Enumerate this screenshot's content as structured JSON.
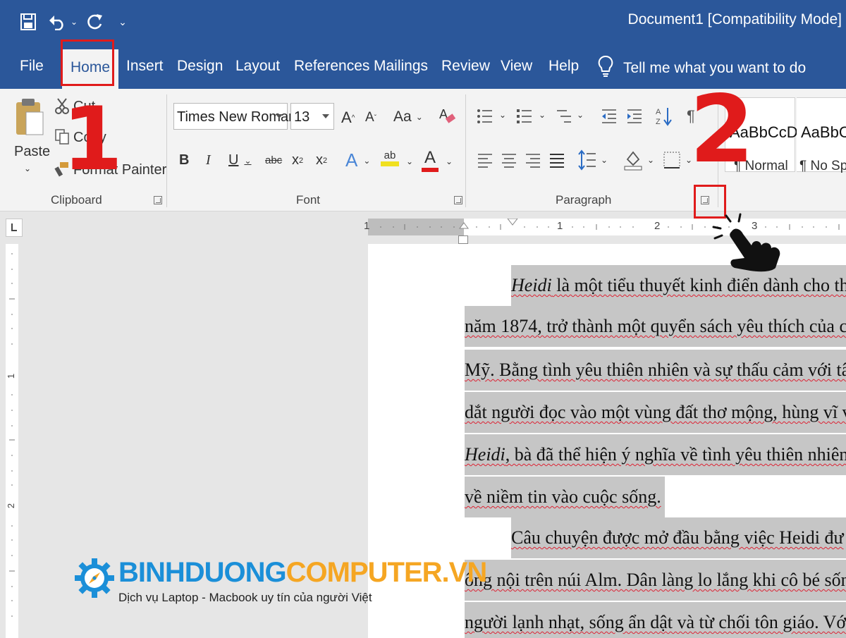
{
  "window": {
    "title": "Document1 [Compatibility Mode]"
  },
  "quick_access": {
    "save_icon": "save-icon",
    "undo_icon": "undo-icon",
    "redo_icon": "redo-icon"
  },
  "menu": {
    "tabs": [
      "File",
      "Home",
      "Insert",
      "Design",
      "Layout",
      "References",
      "Mailings",
      "Review",
      "View",
      "Help"
    ],
    "active": "Home",
    "tell_me": "Tell me what you want to do"
  },
  "clipboard": {
    "label": "Clipboard",
    "paste": "Paste",
    "cut": "Cut",
    "copy": "Copy",
    "format_painter": "Format Painter"
  },
  "font": {
    "label": "Font",
    "name": "Times New Romar",
    "size": "13",
    "bold": "B",
    "italic": "I",
    "underline": "U",
    "strike": "abc",
    "subscript": "x",
    "subscript_mark": "2",
    "superscript": "x",
    "superscript_mark": "2",
    "grow": "A",
    "shrink": "A",
    "case": "Aa",
    "effects": "A",
    "highlight": "ab",
    "color": "A"
  },
  "paragraph": {
    "label": "Paragraph",
    "pilcrow": "¶"
  },
  "styles": {
    "items": [
      {
        "sample": "AaBbCcD",
        "name": "¶ Normal"
      },
      {
        "sample": "AaBbC",
        "name": "¶ No Spa"
      }
    ]
  },
  "ruler": {
    "marks": [
      "1",
      "1",
      "2",
      "3"
    ],
    "vmarks": [
      "1",
      "2"
    ]
  },
  "document": {
    "lines": [
      {
        "parts": [
          {
            "t": "Heidi",
            "i": true
          },
          {
            "t": " là một tiểu thuyết kinh điển dành cho th"
          }
        ]
      },
      {
        "parts": [
          {
            "t": "năm 1874, trở thành một quyển sách yêu thích của c"
          }
        ]
      },
      {
        "parts": [
          {
            "t": "Mỹ. Bằng tình yêu thiên nhiên và sự thấu cảm với tâm"
          }
        ]
      },
      {
        "parts": [
          {
            "t": "dắt người đọc vào một vùng đất thơ mộng, hùng vĩ v"
          }
        ]
      },
      {
        "parts": [
          {
            "t": "Heidi",
            "i": true
          },
          {
            "t": ", bà đã thể hiện ý nghĩa về tình yêu thiên nhiên,"
          }
        ]
      },
      {
        "parts": [
          {
            "t": "về niềm tin vào cuộc sống."
          }
        ]
      },
      {
        "parts": [
          {
            "t": "Câu chuyện được mở đầu bằng việc Heidi đư"
          }
        ]
      },
      {
        "parts": [
          {
            "t": "ông nội trên núi Alm. Dân làng lo lắng khi cô bé sống"
          }
        ]
      },
      {
        "parts": [
          {
            "t": "người lạnh nhạt, sống ẩn dật và từ chối tôn giáo. Với"
          }
        ]
      }
    ]
  },
  "annotations": {
    "step1": "1",
    "step2": "2"
  },
  "watermark": {
    "brand_part1": "BINHDUONG",
    "brand_part2": "COMPUTER.VN",
    "tagline": "Dịch vụ Laptop - Macbook uy tín của người Việt",
    "color1": "#1b8fd8",
    "color2": "#f5a623"
  },
  "colors": {
    "ribbon_blue": "#2b579a",
    "annotation_red": "#e01b1b",
    "selection_gray": "#c6c6c6"
  }
}
